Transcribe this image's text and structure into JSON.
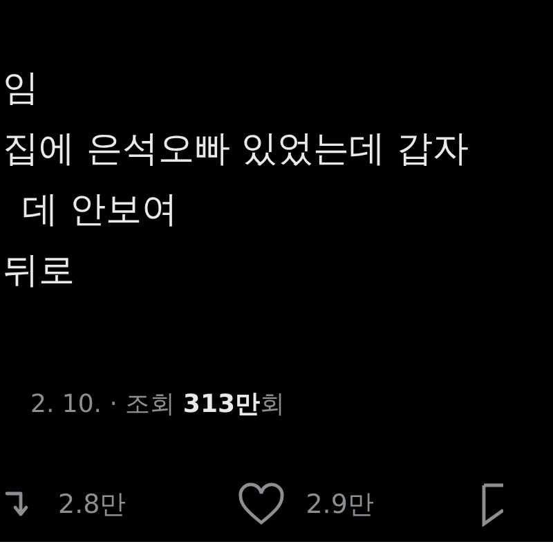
{
  "tweet": {
    "lines": [
      "임",
      "집에 은석오빠 있었는데 갑자",
      "데 안보여",
      "뒤로"
    ],
    "meta": "2. 10. · 조회 **313만**회",
    "stats": [
      {
        "kind": "retweet",
        "count": "2.8만"
      },
      {
        "kind": "like",
        "count": "2.9만"
      },
      {
        "kind": "bookmark"
      }
    ]
  }
}
